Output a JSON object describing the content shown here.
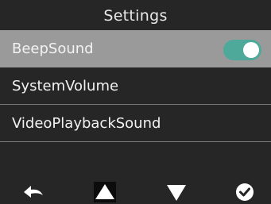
{
  "header": {
    "title": "Settings"
  },
  "menu": {
    "items": [
      {
        "label": "BeepSound",
        "selected": true,
        "toggle": {
          "on": true,
          "color": "#4fa99a"
        }
      },
      {
        "label": "SystemVolume",
        "selected": false
      },
      {
        "label": "VideoPlaybackSound",
        "selected": false
      }
    ]
  },
  "footer": {
    "icons": [
      "back-arrow-icon",
      "up-triangle-icon",
      "down-triangle-icon",
      "check-circle-icon"
    ]
  },
  "colors": {
    "background": "#262626",
    "selected_row": "#9a9a9a",
    "toggle_on": "#4fa99a"
  }
}
